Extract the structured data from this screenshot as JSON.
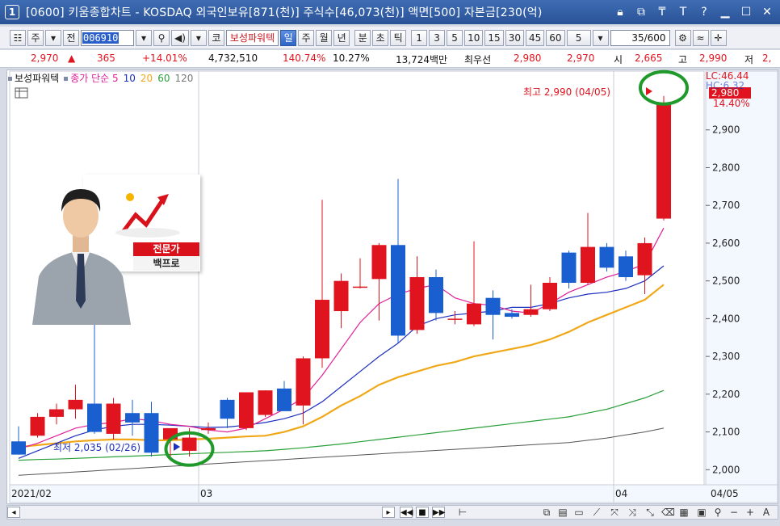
{
  "window": {
    "number": "1",
    "title": "[0600] 키움종합차트 - KOSDAQ 외국인보유[871(천)] 주식수[46,073(천)] 액면[500] 자본금[230(억)"
  },
  "toolbar": {
    "market": "주",
    "prev_label": "전",
    "code": "006910",
    "stock_name": "보성파워텍",
    "period_buttons": [
      "일",
      "주",
      "월",
      "년",
      "분",
      "초",
      "틱"
    ],
    "active_period": "일",
    "minute_buttons": [
      "1",
      "3",
      "5",
      "10",
      "15",
      "30",
      "45",
      "60"
    ],
    "interval_value": "5",
    "count": "35/600",
    "kor_label": "코"
  },
  "quote": {
    "price": "2,970",
    "change": "365",
    "change_pct": "+14.01%",
    "volume": "4,732,510",
    "vol_ratio": "140.74%",
    "turnover": "10.27%",
    "amount": "13,724백만",
    "best_label": "최우선",
    "best_ask": "2,980",
    "best_bid": "2,970",
    "open_label": "시",
    "open": "2,665",
    "high_label": "고",
    "high": "2,990",
    "low_label": "저",
    "low": "2,"
  },
  "legend": {
    "stock": "보성파워텍",
    "ma_label": "종가 단순 5",
    "ma10": "10",
    "ma20": "20",
    "ma60": "60",
    "ma120": "120"
  },
  "annotations": {
    "high_note": "최고 2,990 (04/05)",
    "low_note": "최저 2,035 (02/26)",
    "last_price_box": "2,980",
    "last_pct": "14.40%",
    "lc_label": "LC:46.44",
    "hc_label": "HC:6.32"
  },
  "expert": {
    "tag": "전문가",
    "name": "백프로"
  },
  "colors": {
    "up": "#e0141e",
    "down": "#1a5fd0",
    "ma5": "#e0209a",
    "ma10": "#1d2fbf",
    "ma20": "#f0a818",
    "ma60": "#2ba03a",
    "ma120": "#555555",
    "marker": "#1f9a2a"
  },
  "chart_data": {
    "type": "candlestick",
    "ylim": [
      1960,
      3030
    ],
    "y_ticks": [
      2000,
      2100,
      2200,
      2300,
      2400,
      2500,
      2600,
      2700,
      2800,
      2900
    ],
    "y_tick_labels": [
      "2,000",
      "2,100",
      "2,200",
      "2,300",
      "2,400",
      "2,500",
      "2,600",
      "2,700",
      "2,800",
      "2,900"
    ],
    "x_labels": [
      "2021/02",
      "03",
      "04",
      "04/05"
    ],
    "candles": [
      {
        "o": 2075,
        "h": 2115,
        "l": 2040,
        "c": 2040
      },
      {
        "o": 2090,
        "h": 2150,
        "l": 2085,
        "c": 2140
      },
      {
        "o": 2140,
        "h": 2175,
        "l": 2120,
        "c": 2160
      },
      {
        "o": 2160,
        "h": 2225,
        "l": 2135,
        "c": 2185
      },
      {
        "o": 2175,
        "h": 2400,
        "l": 2095,
        "c": 2100
      },
      {
        "o": 2095,
        "h": 2190,
        "l": 2080,
        "c": 2175
      },
      {
        "o": 2150,
        "h": 2185,
        "l": 2090,
        "c": 2125
      },
      {
        "o": 2150,
        "h": 2180,
        "l": 2035,
        "c": 2045
      },
      {
        "o": 2080,
        "h": 2100,
        "l": 2035,
        "c": 2110
      },
      {
        "o": 2050,
        "h": 2110,
        "l": 2035,
        "c": 2085
      },
      {
        "o": 2105,
        "h": 2125,
        "l": 2095,
        "c": 2110
      },
      {
        "o": 2185,
        "h": 2190,
        "l": 2110,
        "c": 2135
      },
      {
        "o": 2110,
        "h": 2205,
        "l": 2105,
        "c": 2205
      },
      {
        "o": 2145,
        "h": 2210,
        "l": 2140,
        "c": 2210
      },
      {
        "o": 2215,
        "h": 2235,
        "l": 2155,
        "c": 2155
      },
      {
        "o": 2170,
        "h": 2300,
        "l": 2120,
        "c": 2295
      },
      {
        "o": 2295,
        "h": 2715,
        "l": 2270,
        "c": 2450
      },
      {
        "o": 2420,
        "h": 2520,
        "l": 2375,
        "c": 2500
      },
      {
        "o": 2485,
        "h": 2560,
        "l": 2480,
        "c": 2485
      },
      {
        "o": 2505,
        "h": 2600,
        "l": 2395,
        "c": 2595
      },
      {
        "o": 2595,
        "h": 2770,
        "l": 2335,
        "c": 2355
      },
      {
        "o": 2370,
        "h": 2565,
        "l": 2360,
        "c": 2510
      },
      {
        "o": 2510,
        "h": 2530,
        "l": 2395,
        "c": 2415
      },
      {
        "o": 2400,
        "h": 2420,
        "l": 2385,
        "c": 2400
      },
      {
        "o": 2385,
        "h": 2605,
        "l": 2380,
        "c": 2440
      },
      {
        "o": 2455,
        "h": 2475,
        "l": 2345,
        "c": 2410
      },
      {
        "o": 2415,
        "h": 2425,
        "l": 2400,
        "c": 2405
      },
      {
        "o": 2410,
        "h": 2490,
        "l": 2405,
        "c": 2425
      },
      {
        "o": 2425,
        "h": 2510,
        "l": 2420,
        "c": 2495
      },
      {
        "o": 2575,
        "h": 2580,
        "l": 2480,
        "c": 2495
      },
      {
        "o": 2495,
        "h": 2680,
        "l": 2490,
        "c": 2590
      },
      {
        "o": 2590,
        "h": 2600,
        "l": 2525,
        "c": 2535
      },
      {
        "o": 2565,
        "h": 2580,
        "l": 2500,
        "c": 2510
      },
      {
        "o": 2515,
        "h": 2615,
        "l": 2465,
        "c": 2600
      },
      {
        "o": 2665,
        "h": 2990,
        "l": 2660,
        "c": 2970
      }
    ],
    "ma5": [
      2055,
      2070,
      2090,
      2110,
      2120,
      2125,
      2135,
      2130,
      2120,
      2115,
      2105,
      2100,
      2110,
      2135,
      2160,
      2190,
      2250,
      2320,
      2390,
      2440,
      2465,
      2480,
      2490,
      2455,
      2440,
      2435,
      2420,
      2415,
      2440,
      2470,
      2490,
      2510,
      2525,
      2545,
      2640
    ],
    "ma10": [
      2030,
      2050,
      2070,
      2090,
      2105,
      2115,
      2120,
      2120,
      2118,
      2115,
      2112,
      2113,
      2118,
      2125,
      2135,
      2150,
      2180,
      2220,
      2260,
      2300,
      2335,
      2380,
      2400,
      2410,
      2415,
      2420,
      2430,
      2430,
      2440,
      2455,
      2465,
      2470,
      2480,
      2500,
      2540
    ],
    "ma20": [
      2060,
      2065,
      2070,
      2075,
      2078,
      2080,
      2080,
      2078,
      2078,
      2080,
      2082,
      2085,
      2088,
      2090,
      2100,
      2115,
      2140,
      2170,
      2195,
      2225,
      2245,
      2260,
      2275,
      2285,
      2300,
      2310,
      2320,
      2330,
      2345,
      2365,
      2390,
      2410,
      2430,
      2450,
      2490
    ],
    "ma60": [
      2025,
      2027,
      2028,
      2030,
      2032,
      2034,
      2036,
      2038,
      2040,
      2042,
      2044,
      2046,
      2048,
      2050,
      2054,
      2058,
      2063,
      2068,
      2074,
      2080,
      2086,
      2092,
      2098,
      2104,
      2110,
      2116,
      2122,
      2128,
      2134,
      2140,
      2150,
      2160,
      2175,
      2190,
      2210
    ],
    "ma120": [
      1985,
      1988,
      1991,
      1994,
      1997,
      2000,
      2003,
      2006,
      2009,
      2012,
      2015,
      2018,
      2021,
      2024,
      2027,
      2030,
      2033,
      2036,
      2039,
      2042,
      2045,
      2048,
      2051,
      2054,
      2057,
      2060,
      2063,
      2066,
      2069,
      2072,
      2078,
      2084,
      2092,
      2100,
      2110
    ],
    "highlight_circles": [
      9,
      34
    ]
  }
}
